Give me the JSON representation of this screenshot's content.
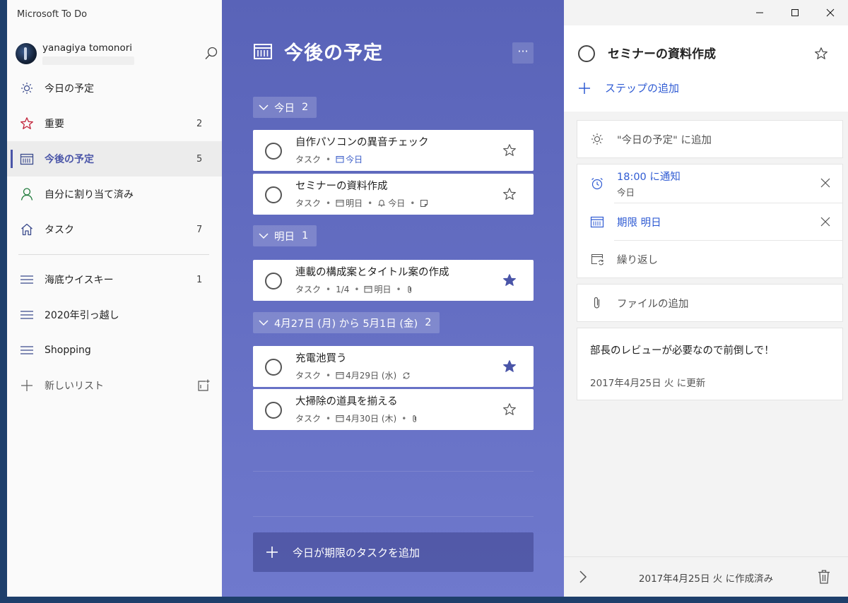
{
  "app": {
    "title": "Microsoft To Do"
  },
  "colors": {
    "accent": "#4a55a8",
    "main_bg": "#5963b8",
    "link_blue": "#2f5bd3"
  },
  "profile": {
    "name": "yanagiya tomonori"
  },
  "sidebar": {
    "items": [
      {
        "label": "今日の予定",
        "count": "",
        "icon": "sun-icon"
      },
      {
        "label": "重要",
        "count": "2",
        "icon": "star-icon"
      },
      {
        "label": "今後の予定",
        "count": "5",
        "icon": "calendar-icon",
        "active": true
      },
      {
        "label": "自分に割り当て済み",
        "count": "",
        "icon": "person-icon"
      },
      {
        "label": "タスク",
        "count": "7",
        "icon": "home-icon"
      }
    ],
    "lists": [
      {
        "label": "海底ウイスキー",
        "count": "1",
        "icon": "list-icon"
      },
      {
        "label": "2020年引っ越し",
        "count": "",
        "icon": "list-icon"
      },
      {
        "label": "Shopping",
        "count": "",
        "icon": "list-icon"
      }
    ],
    "new_list_label": "新しいリスト"
  },
  "main": {
    "title": "今後の予定",
    "more_label": "···",
    "groups": [
      {
        "label": "今日",
        "count": "2",
        "tasks": [
          {
            "title": "自作パソコンの異音チェック",
            "list": "タスク",
            "due": "今日",
            "starred": false
          },
          {
            "title": "セミナーの資料作成",
            "list": "タスク",
            "due": "明日",
            "reminder": "今日",
            "starred": false
          }
        ]
      },
      {
        "label": "明日",
        "count": "1",
        "tasks": [
          {
            "title": "連載の構成案とタイトル案の作成",
            "list": "タスク",
            "steps": "1/4",
            "due": "明日",
            "starred": true
          }
        ]
      },
      {
        "label": "4月27日 (月) から 5月1日 (金)",
        "count": "2",
        "tasks": [
          {
            "title": "充電池買う",
            "list": "タスク",
            "due": "4月29日 (水)",
            "starred": true
          },
          {
            "title": "大掃除の道具を揃える",
            "list": "タスク",
            "due": "4月30日 (木)",
            "starred": false
          }
        ]
      }
    ],
    "add_task_label": "今日が期限のタスクを追加"
  },
  "detail": {
    "title": "セミナーの資料作成",
    "add_step": "ステップの追加",
    "add_to_myday": "\"今日の予定\" に追加",
    "reminder": {
      "title": "18:00 に通知",
      "sub": "今日"
    },
    "due": "期限 明日",
    "repeat": "繰り返し",
    "add_file": "ファイルの追加",
    "note": "部長のレビューが必要なので前倒しで！",
    "updated": "2017年4月25日 火 に更新",
    "created": "2017年4月25日 火 に作成済み"
  }
}
